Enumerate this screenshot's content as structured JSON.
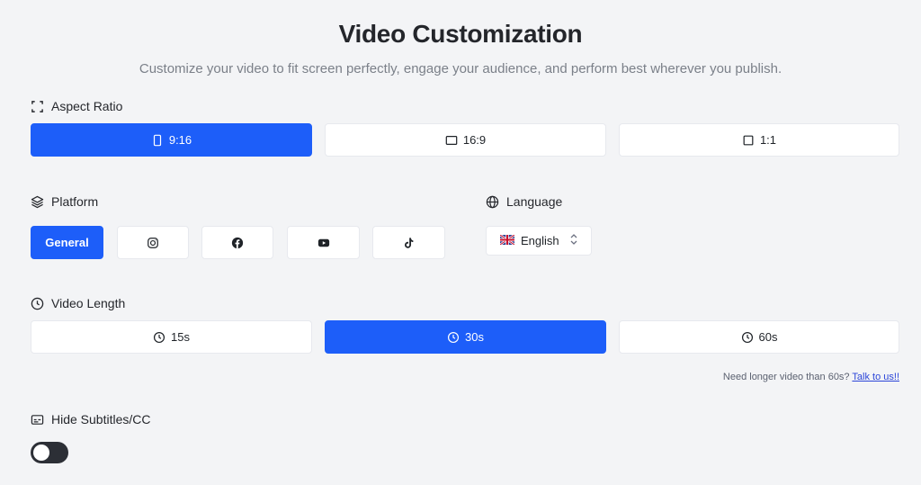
{
  "header": {
    "title": "Video Customization",
    "subtitle": "Customize your video to fit screen perfectly, engage your audience, and perform best wherever you publish."
  },
  "aspect_ratio": {
    "label": "Aspect Ratio",
    "icon": "expand-corners-icon",
    "options": [
      {
        "label": "9:16",
        "icon": "portrait-rect-icon",
        "selected": true
      },
      {
        "label": "16:9",
        "icon": "landscape-rect-icon",
        "selected": false
      },
      {
        "label": "1:1",
        "icon": "square-icon",
        "selected": false
      }
    ]
  },
  "platform": {
    "label": "Platform",
    "icon": "layers-icon",
    "options": [
      {
        "label": "General",
        "icon": "",
        "selected": true
      },
      {
        "label": "",
        "icon": "instagram-icon",
        "selected": false
      },
      {
        "label": "",
        "icon": "facebook-icon",
        "selected": false
      },
      {
        "label": "",
        "icon": "youtube-icon",
        "selected": false
      },
      {
        "label": "",
        "icon": "tiktok-icon",
        "selected": false
      }
    ]
  },
  "language": {
    "label": "Language",
    "icon": "globe-icon",
    "selected": "English",
    "flag_icon": "uk-flag-icon",
    "chevron_icon": "chevron-updown-icon"
  },
  "video_length": {
    "label": "Video Length",
    "icon": "clock-icon",
    "options": [
      {
        "label": "15s",
        "icon": "clock-icon",
        "selected": false
      },
      {
        "label": "30s",
        "icon": "clock-icon",
        "selected": true
      },
      {
        "label": "60s",
        "icon": "clock-icon",
        "selected": false
      }
    ],
    "note_text": "Need longer video than 60s?",
    "note_link": "Talk to us!!"
  },
  "subtitles": {
    "label": "Hide Subtitles/CC",
    "icon": "subtitles-icon",
    "enabled": false
  },
  "colors": {
    "accent": "#1d5ef9",
    "background": "#f3f4f6",
    "toggle": "#2c2f36",
    "link": "#2b45d8"
  }
}
